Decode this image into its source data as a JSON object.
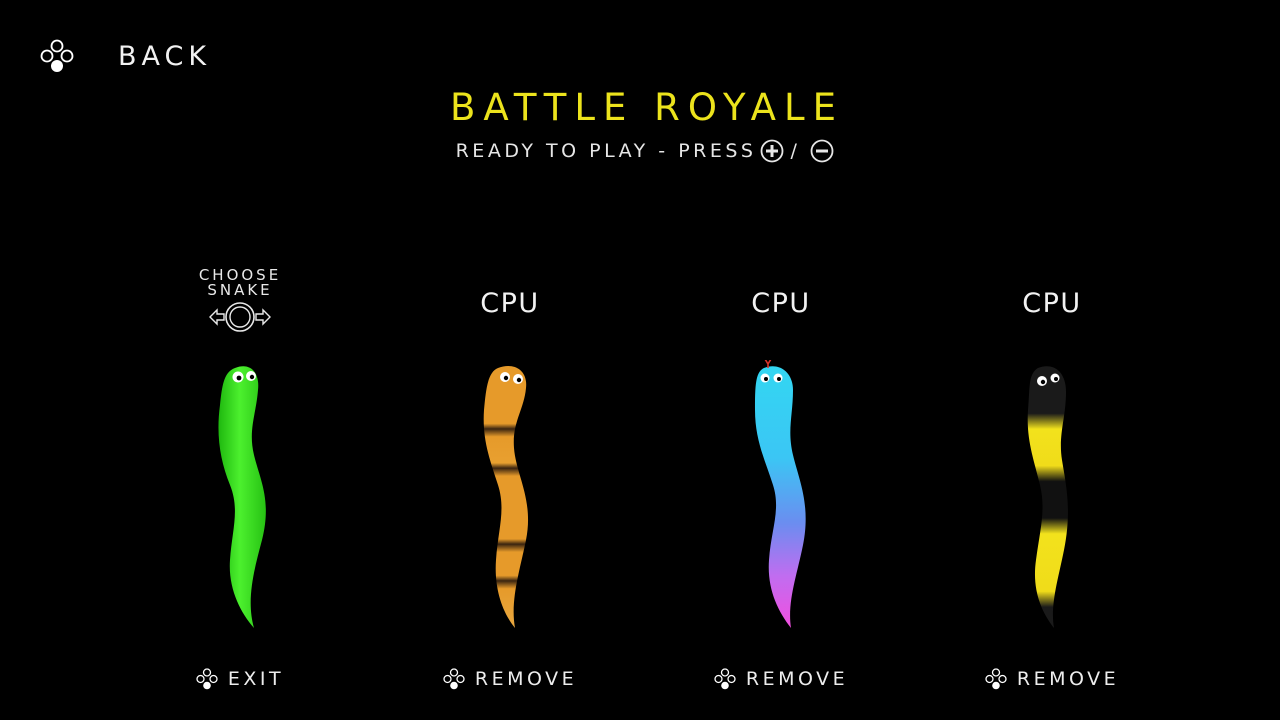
{
  "header": {
    "back_label": "BACK",
    "title": "BATTLE ROYALE",
    "subtitle_text": "READY TO PLAY - PRESS",
    "subtitle_separator": "/",
    "title_color": "#ece31c"
  },
  "choose_prompt": {
    "line1": "CHOOSE",
    "line2": "SNAKE"
  },
  "slots": [
    {
      "action_label": "EXIT",
      "snake_color": "green"
    },
    {
      "label": "CPU",
      "action_label": "REMOVE",
      "snake_color": "orange-striped"
    },
    {
      "label": "CPU",
      "action_label": "REMOVE",
      "snake_color": "cyan-magenta"
    },
    {
      "label": "CPU",
      "action_label": "REMOVE",
      "snake_color": "yellow-black"
    }
  ],
  "icons": {
    "back": "face-buttons-icon",
    "plus": "plus-button-icon",
    "minus": "minus-button-icon",
    "stick": "left-stick-icon",
    "action": "face-buttons-icon"
  }
}
